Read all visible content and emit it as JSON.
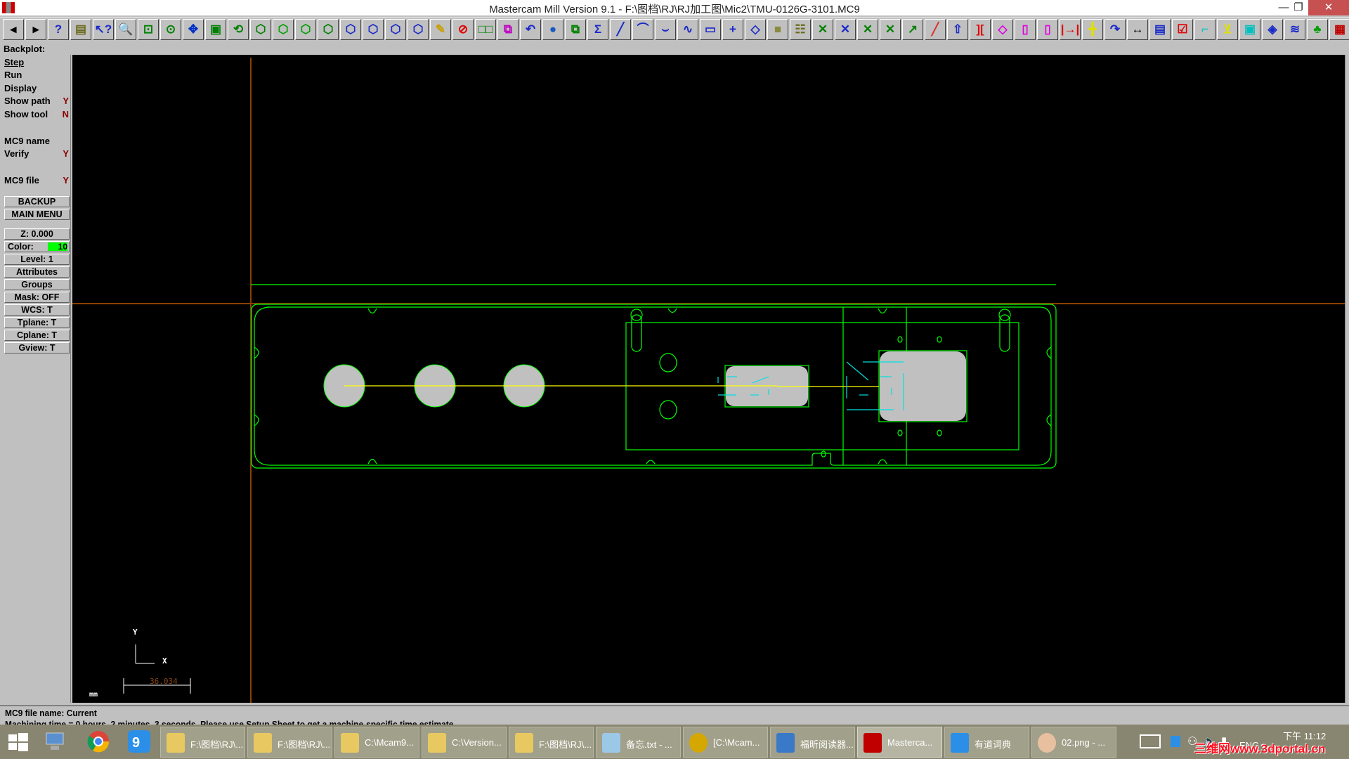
{
  "window": {
    "title": "Mastercam Mill Version 9.1 - F:\\图档\\RJ\\RJ加工图\\Mic2\\TMU-0126G-3101.MC9",
    "minimize": "—",
    "maximize": "❐",
    "close": "✕"
  },
  "toolbar": {
    "buttons": [
      {
        "name": "back-icon",
        "glyph": "◂",
        "color": "#000"
      },
      {
        "name": "forward-icon",
        "glyph": "▸",
        "color": "#000"
      },
      {
        "name": "help-icon",
        "glyph": "?",
        "color": "#1a2ac8"
      },
      {
        "name": "file-cabinet-icon",
        "glyph": "▤",
        "color": "#6b6b20"
      },
      {
        "name": "analyze-icon",
        "glyph": "↖?",
        "color": "#1a2ac8"
      },
      {
        "name": "zoom-window-icon",
        "glyph": "🔍",
        "color": "#008000"
      },
      {
        "name": "zoom-icon",
        "glyph": "⊡",
        "color": "#008000"
      },
      {
        "name": "zoom-half-icon",
        "glyph": "⊙",
        "color": "#008000"
      },
      {
        "name": "pan-icon",
        "glyph": "✥",
        "color": "#0030c8"
      },
      {
        "name": "fit-icon",
        "glyph": "▣",
        "color": "#008000"
      },
      {
        "name": "rotate-view-icon",
        "glyph": "⟲",
        "color": "#008000"
      },
      {
        "name": "view-top-icon",
        "glyph": "⬡",
        "color": "#008000"
      },
      {
        "name": "view-front-icon",
        "glyph": "⬡",
        "color": "#00a000"
      },
      {
        "name": "view-side-icon",
        "glyph": "⬡",
        "color": "#00a000"
      },
      {
        "name": "view-iso-icon",
        "glyph": "⬡",
        "color": "#008000"
      },
      {
        "name": "cplane-top-icon",
        "glyph": "⬡",
        "color": "#1a2ac8"
      },
      {
        "name": "cplane-front-icon",
        "glyph": "⬡",
        "color": "#1a2ac8"
      },
      {
        "name": "cplane-side-icon",
        "glyph": "⬡",
        "color": "#1a2ac8"
      },
      {
        "name": "cplane-3d-icon",
        "glyph": "⬡",
        "color": "#1a2ac8"
      },
      {
        "name": "pencil-icon",
        "glyph": "✎",
        "color": "#c8a000"
      },
      {
        "name": "no-pencil-icon",
        "glyph": "⊘",
        "color": "#e00000"
      },
      {
        "name": "translate-icon",
        "glyph": "□□",
        "color": "#008000"
      },
      {
        "name": "copy-icon",
        "glyph": "⧉",
        "color": "#c000c0"
      },
      {
        "name": "undo-icon",
        "glyph": "↶",
        "color": "#1a2ac8"
      },
      {
        "name": "shade-icon",
        "glyph": "●",
        "color": "#1a5ac0"
      },
      {
        "name": "scale-icon",
        "glyph": "⧉",
        "color": "#008000"
      },
      {
        "name": "sum-icon",
        "glyph": "Σ",
        "color": "#1a2ac8"
      },
      {
        "name": "line-icon",
        "glyph": "╱",
        "color": "#1a2ac8"
      },
      {
        "name": "arc-icon",
        "glyph": "⌒",
        "color": "#1a2ac8"
      },
      {
        "name": "fillet-icon",
        "glyph": "⌣",
        "color": "#1a2ac8"
      },
      {
        "name": "spline-icon",
        "glyph": "∿",
        "color": "#1a2ac8"
      },
      {
        "name": "rectangle-icon",
        "glyph": "▭",
        "color": "#1a2ac8"
      },
      {
        "name": "point-icon",
        "glyph": "+",
        "color": "#1a2ac8"
      },
      {
        "name": "surface-icon",
        "glyph": "◇",
        "color": "#1a2ac8"
      },
      {
        "name": "solid-icon",
        "glyph": "■",
        "color": "#8b8b40"
      },
      {
        "name": "operations-manager-icon",
        "glyph": "☷",
        "color": "#6b6b20"
      },
      {
        "name": "trim-icon",
        "glyph": "✕",
        "color": "#008000"
      },
      {
        "name": "trim2-icon",
        "glyph": "✕",
        "color": "#1a2ac8"
      },
      {
        "name": "break-icon",
        "glyph": "✕",
        "color": "#008000"
      },
      {
        "name": "divide-icon",
        "glyph": "✕",
        "color": "#008000"
      },
      {
        "name": "extend-icon",
        "glyph": "↗",
        "color": "#008000"
      },
      {
        "name": "break-at-point-icon",
        "glyph": "╱",
        "color": "#e03030"
      },
      {
        "name": "project-icon",
        "glyph": "⇧",
        "color": "#1a2ac8"
      },
      {
        "name": "mirror-icon",
        "glyph": "][",
        "color": "#e00000"
      },
      {
        "name": "rotate-icon",
        "glyph": "◇",
        "color": "#e000e0"
      },
      {
        "name": "scale-xform-icon",
        "glyph": "▯",
        "color": "#e000e0"
      },
      {
        "name": "translate-xform-icon",
        "glyph": "▯",
        "color": "#e000e0"
      },
      {
        "name": "offset-icon",
        "glyph": "|→|",
        "color": "#e00000"
      },
      {
        "name": "dimension-icon",
        "glyph": "╋",
        "color": "#e0e000"
      },
      {
        "name": "xyz-icon",
        "glyph": "↷",
        "color": "#1a2ac8"
      },
      {
        "name": "measure-icon",
        "glyph": "↔",
        "color": "#000"
      },
      {
        "name": "setup-sheet-icon",
        "glyph": "▤",
        "color": "#1a2ac8"
      },
      {
        "name": "checklist-icon",
        "glyph": "☑",
        "color": "#e00000"
      },
      {
        "name": "contour-icon",
        "glyph": "⌐",
        "color": "#00c0c0"
      },
      {
        "name": "drill-icon",
        "glyph": "⊻",
        "color": "#e0e000"
      },
      {
        "name": "pocket-icon",
        "glyph": "▣",
        "color": "#00c0c0"
      },
      {
        "name": "surface-rough-icon",
        "glyph": "◈",
        "color": "#1a2ac8"
      },
      {
        "name": "surface-finish-icon",
        "glyph": "≋",
        "color": "#1a2ac8"
      },
      {
        "name": "tool-icon",
        "glyph": "♣",
        "color": "#00a000"
      },
      {
        "name": "wall-icon",
        "glyph": "▦",
        "color": "#c00000"
      }
    ]
  },
  "backplot": {
    "title": "Backplot:",
    "menu": [
      {
        "label": "Step",
        "flag": ""
      },
      {
        "label": "Run",
        "flag": ""
      },
      {
        "label": "Display",
        "flag": ""
      },
      {
        "label": "Show path",
        "flag": "Y"
      },
      {
        "label": "Show tool",
        "flag": "N"
      },
      {
        "label": "MC9 name",
        "flag": ""
      },
      {
        "label": "Verify",
        "flag": "Y"
      },
      {
        "label": "MC9 file",
        "flag": "Y"
      }
    ],
    "backup": "BACKUP",
    "main_menu": "MAIN MENU"
  },
  "settings": {
    "z": "Z:  0.000",
    "color_label": "Color:",
    "color_value": "10",
    "color_hex": "#00ff00",
    "level": "Level:  1",
    "attributes": "Attributes",
    "groups": "Groups",
    "mask": "Mask:  OFF",
    "wcs": "WCS:   T",
    "tplane": "Tplane:  T",
    "cplane": "Cplane:  T",
    "gview": "Gview:   T"
  },
  "viewport": {
    "axis_y": "Y",
    "axis_x": "X",
    "scale_value": "36.034",
    "units": "mm",
    "colors": {
      "geometry": "#00ff00",
      "toolpath": "#ffff00",
      "stock": "#c0c0c0",
      "axis": "#8b4000",
      "detail": "#00e0e0"
    }
  },
  "status": {
    "line1": "MC9 file name: Current",
    "line2": "Machining time = 0 hours, 2 minutes, 3 seconds. Please use Setup Sheet to get a machine-specific time estimate."
  },
  "taskbar": {
    "tasks": [
      {
        "label": "F:\\图档\\RJ\\...",
        "icon": "folder-icon"
      },
      {
        "label": "F:\\图档\\RJ\\...",
        "icon": "folder-icon"
      },
      {
        "label": "C:\\Mcam9...",
        "icon": "folder-icon"
      },
      {
        "label": "C:\\Version...",
        "icon": "folder-icon"
      },
      {
        "label": "F:\\图档\\RJ\\...",
        "icon": "folder-icon"
      },
      {
        "label": "备忘.txt - ...",
        "icon": "notepad-icon"
      },
      {
        "label": "[C:\\Mcam...",
        "icon": "ultraedit-icon"
      },
      {
        "label": "福昕阅读器...",
        "icon": "foxit-icon"
      },
      {
        "label": "Masterca...",
        "icon": "mastercam-icon",
        "active": true
      },
      {
        "label": "有道词典",
        "icon": "youdao-icon"
      },
      {
        "label": "02.png - ...",
        "icon": "paint-icon"
      }
    ],
    "tray": {
      "lang": "ENG",
      "time": "下午 11:12",
      "watermark": "三维网www.3dportal.cn"
    }
  }
}
